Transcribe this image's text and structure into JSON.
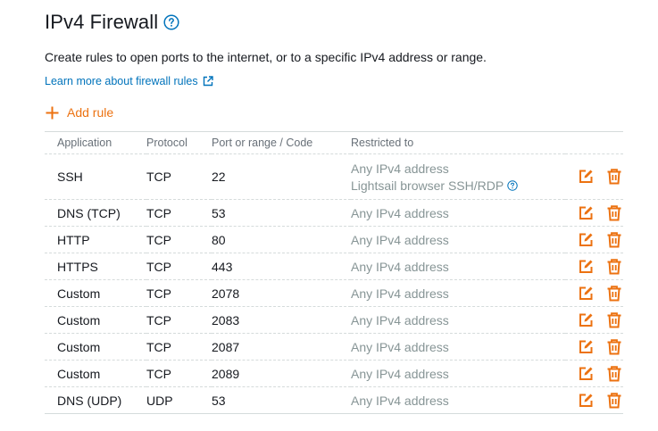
{
  "header": {
    "title": "IPv4 Firewall",
    "description": "Create rules to open ports to the internet, or to a specific IPv4 address or range.",
    "learn_more": "Learn more about firewall rules",
    "add_rule": "Add rule"
  },
  "table": {
    "columns": [
      "Application",
      "Protocol",
      "Port or range / Code",
      "Restricted to"
    ],
    "rows": [
      {
        "app": "SSH",
        "protocol": "TCP",
        "port": "22",
        "restricted": "Any IPv4 address",
        "restricted_extra": "Lightsail browser SSH/RDP"
      },
      {
        "app": "DNS (TCP)",
        "protocol": "TCP",
        "port": "53",
        "restricted": "Any IPv4 address"
      },
      {
        "app": "HTTP",
        "protocol": "TCP",
        "port": "80",
        "restricted": "Any IPv4 address"
      },
      {
        "app": "HTTPS",
        "protocol": "TCP",
        "port": "443",
        "restricted": "Any IPv4 address"
      },
      {
        "app": "Custom",
        "protocol": "TCP",
        "port": "2078",
        "restricted": "Any IPv4 address"
      },
      {
        "app": "Custom",
        "protocol": "TCP",
        "port": "2083",
        "restricted": "Any IPv4 address"
      },
      {
        "app": "Custom",
        "protocol": "TCP",
        "port": "2087",
        "restricted": "Any IPv4 address"
      },
      {
        "app": "Custom",
        "protocol": "TCP",
        "port": "2089",
        "restricted": "Any IPv4 address"
      },
      {
        "app": "DNS (UDP)",
        "protocol": "UDP",
        "port": "53",
        "restricted": "Any IPv4 address"
      }
    ]
  },
  "icons": {
    "help": "question-circle-icon",
    "external": "external-link-icon",
    "add": "plus-icon",
    "edit": "edit-icon",
    "delete": "trash-icon"
  },
  "colors": {
    "accent": "#ec7211",
    "link": "#0073bb",
    "muted": "#879596",
    "header_text": "#687078"
  }
}
